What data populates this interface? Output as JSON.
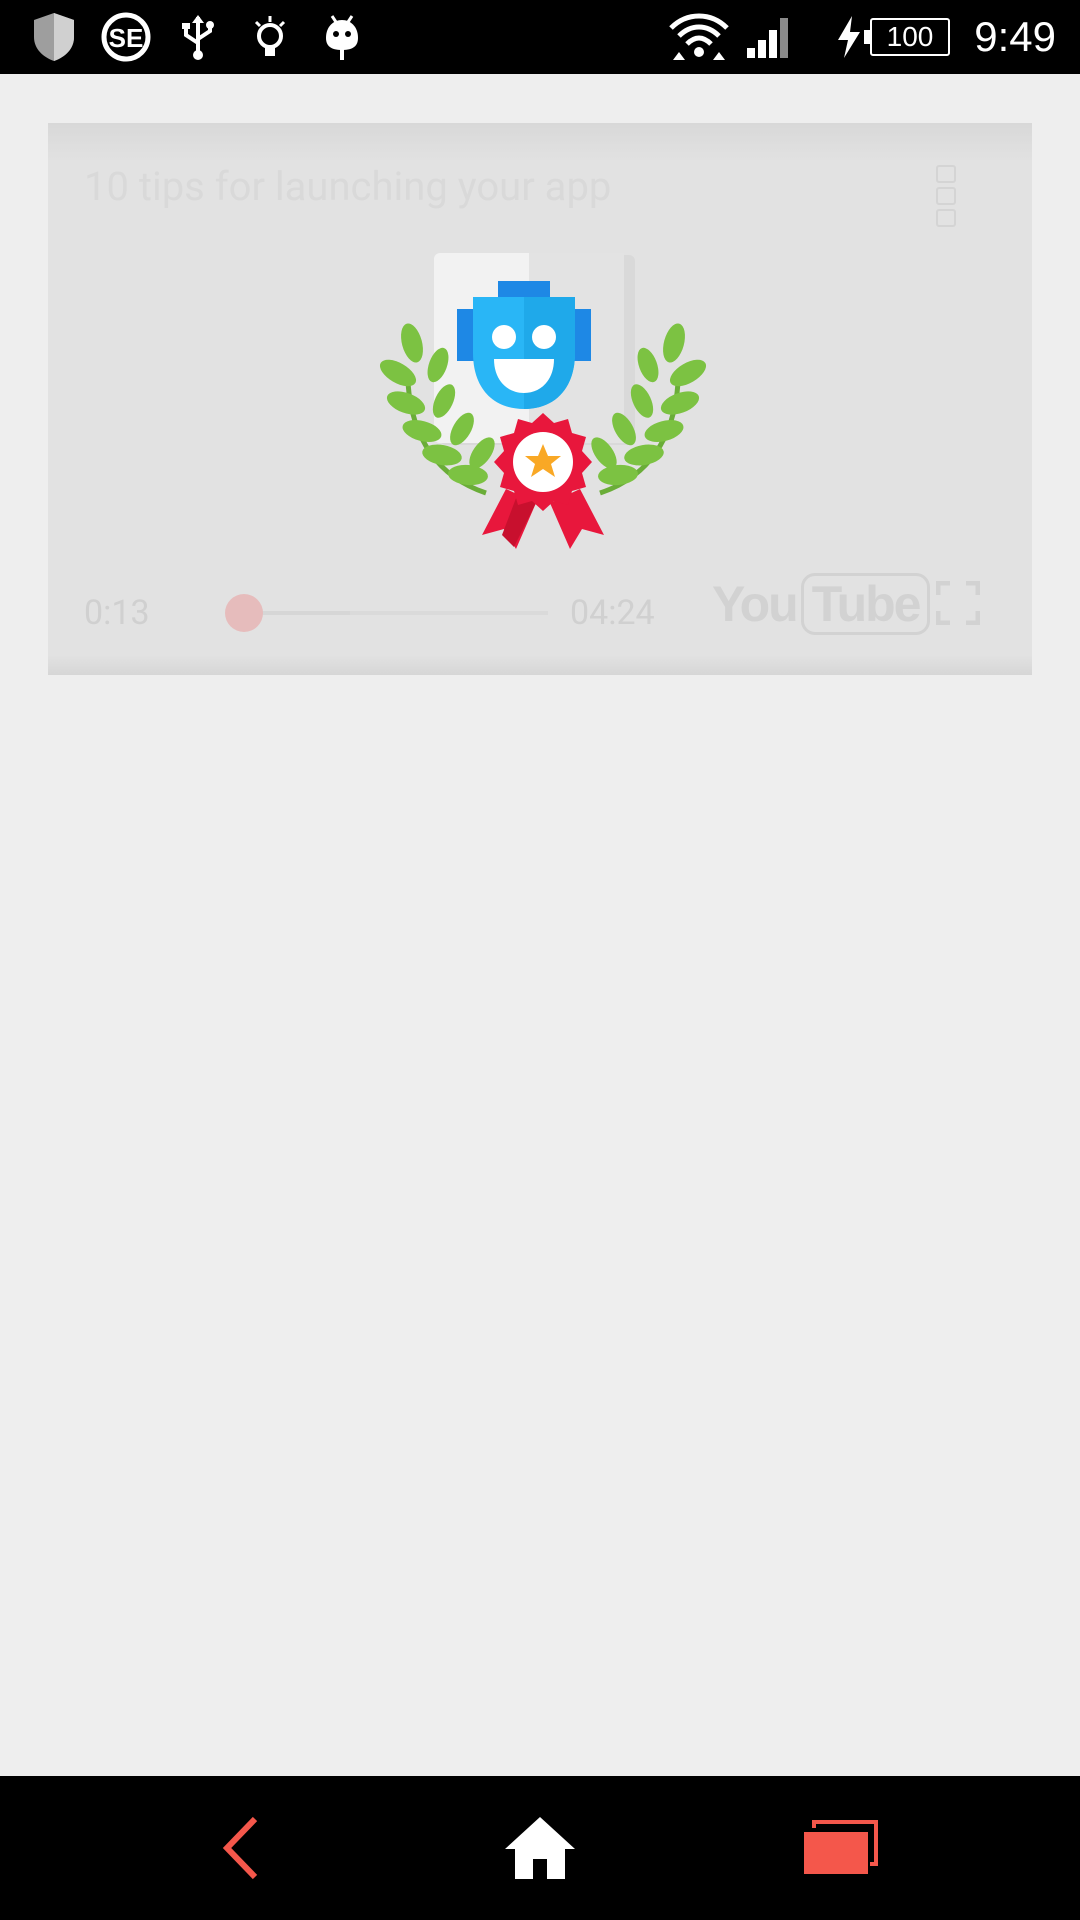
{
  "status_bar": {
    "time": "9:49",
    "battery_level": "100",
    "icons": [
      "shield-icon",
      "se-icon",
      "usb-icon",
      "lightbulb-icon",
      "android-icon",
      "wifi-icon",
      "cell-signal-icon",
      "charging-icon",
      "battery-icon"
    ]
  },
  "player": {
    "title": "10 tips for launching your app",
    "time_current": "0:13",
    "time_total": "04:24",
    "progress_fraction": 0.05,
    "buffered_fraction": 0.38,
    "logo_you": "You",
    "logo_tube": "Tube",
    "accent_color": "#e6bcbc"
  },
  "nav_bar": {
    "buttons": [
      "back-icon",
      "home-icon",
      "recents-icon"
    ],
    "accent_color": "#f4574b"
  }
}
